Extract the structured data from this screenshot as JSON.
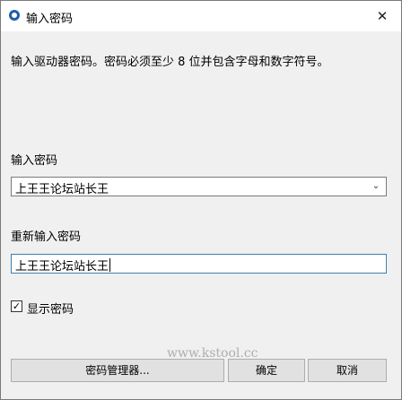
{
  "window": {
    "title": "输入密码",
    "close_symbol": "✕"
  },
  "instruction": "输入驱动器密码。密码必须至少 8 位并包含字母和数字符号。",
  "password_combo": {
    "label": "输入密码",
    "value": "上王王论坛站长王",
    "arrow": "⌄"
  },
  "confirm_field": {
    "label": "重新输入密码",
    "value": "上王王论坛站长王"
  },
  "show_password": {
    "checked": true,
    "check_mark": "✓",
    "label": "显示密码"
  },
  "buttons": {
    "manage": "密码管理器...",
    "ok": "确定",
    "cancel": "取消"
  },
  "watermark": "www.kstool.cc"
}
